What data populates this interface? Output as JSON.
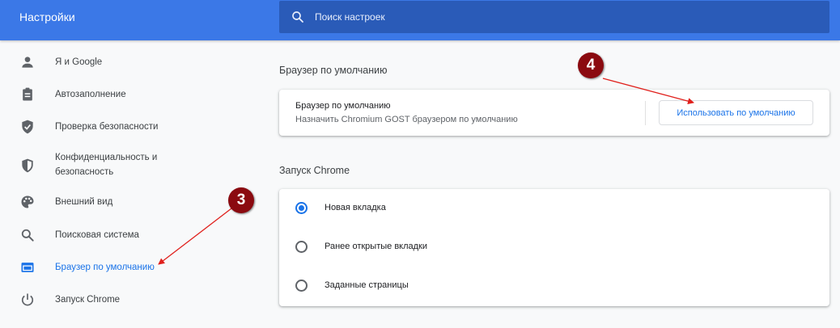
{
  "header": {
    "title": "Настройки",
    "search_placeholder": "Поиск настроек"
  },
  "sidebar": {
    "items": [
      {
        "label": "Я и Google",
        "icon": "person-icon"
      },
      {
        "label": "Автозаполнение",
        "icon": "clipboard-icon"
      },
      {
        "label": "Проверка безопасности",
        "icon": "shield-check-icon"
      },
      {
        "label": "Конфиденциальность и безопасность",
        "label_line1": "Конфиденциальность и",
        "label_line2": "безопасность",
        "icon": "shield-half-icon"
      },
      {
        "label": "Внешний вид",
        "icon": "palette-icon"
      },
      {
        "label": "Поисковая система",
        "icon": "search-icon"
      },
      {
        "label": "Браузер по умолчанию",
        "icon": "browser-window-icon",
        "active": true
      },
      {
        "label": "Запуск Chrome",
        "icon": "power-icon"
      }
    ]
  },
  "default_browser": {
    "section_title": "Браузер по умолчанию",
    "card_title": "Браузер по умолчанию",
    "card_subtitle": "Назначить Chromium GOST браузером по умолчанию",
    "button_label": "Использовать по умолчанию"
  },
  "startup": {
    "section_title": "Запуск Chrome",
    "options": [
      {
        "label": "Новая вкладка",
        "checked": true
      },
      {
        "label": "Ранее открытые вкладки",
        "checked": false
      },
      {
        "label": "Заданные страницы",
        "checked": false
      }
    ]
  },
  "annotations": {
    "badge_3": "3",
    "badge_4": "4"
  },
  "colors": {
    "topbar": "#3b78e7",
    "accent": "#1a73e8",
    "badge": "#8b0a10",
    "arrow": "#e0201c"
  }
}
